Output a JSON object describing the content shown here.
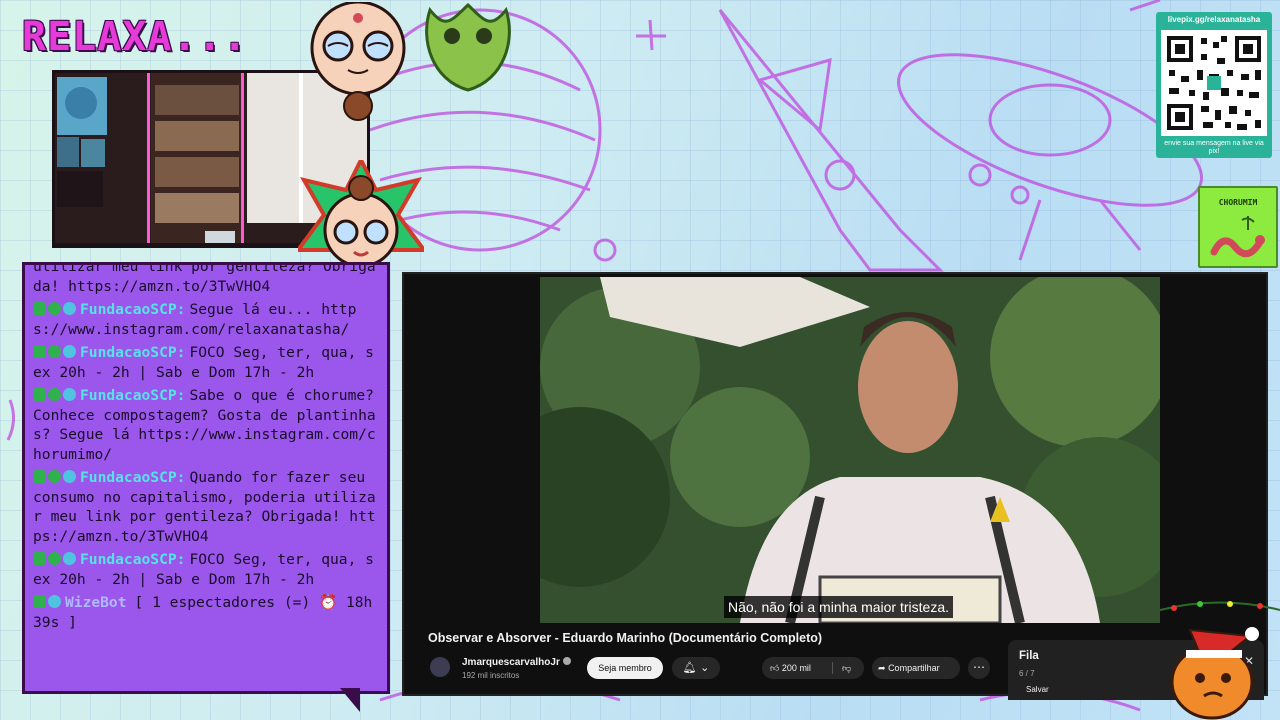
{
  "overlay": {
    "title": "RELAXA..."
  },
  "qr": {
    "url": "livepix.gg/relaxanatasha",
    "caption": "envie sua mensagem na live via pix!"
  },
  "sponsor": {
    "label": "CHORUMIM"
  },
  "chat": {
    "messages": [
      {
        "cut": true,
        "user": "",
        "text": "utilizar meu link por gentileza? Obrigada! https://amzn.to/3TwVHO4"
      },
      {
        "cut": false,
        "user": "FundacaoSCP:",
        "text": "Segue lá eu... https://www.instagram.com/relaxanatasha/"
      },
      {
        "cut": false,
        "user": "FundacaoSCP:",
        "text": "FOCO Seg, ter, qua, sex 20h - 2h | Sab e Dom 17h - 2h"
      },
      {
        "cut": false,
        "user": "FundacaoSCP:",
        "text": "Sabe o que é chorume? Conhece compostagem? Gosta de plantinhas? Segue lá https://www.instagram.com/chorumimo/"
      },
      {
        "cut": false,
        "user": "FundacaoSCP:",
        "text": "Quando for fazer seu consumo no capitalismo, poderia utilizar meu link por gentileza? Obrigada! https://amzn.to/3TwVHO4"
      },
      {
        "cut": false,
        "user": "FundacaoSCP:",
        "text": "FOCO Seg, ter, qua, sex 20h - 2h | Sab e Dom 17h - 2h"
      }
    ],
    "bot": {
      "name": "WizeBot",
      "text": "[ 1 espectadores (=) ⏰ 18h 39s ]"
    }
  },
  "video": {
    "subtitle": "Não, não foi a minha maior tristeza.",
    "title": "Observar e Absorver - Eduardo Marinho (Documentário Completo)",
    "channel": "JmarquescarvalhoJr",
    "subscribers": "192 mil inscritos",
    "join_label": "Seja membro",
    "likes": "200 mil",
    "share_label": "Compartilhar"
  },
  "playlist": {
    "title": "Fila",
    "count": "6 / 7",
    "save_label": "Salvar"
  }
}
